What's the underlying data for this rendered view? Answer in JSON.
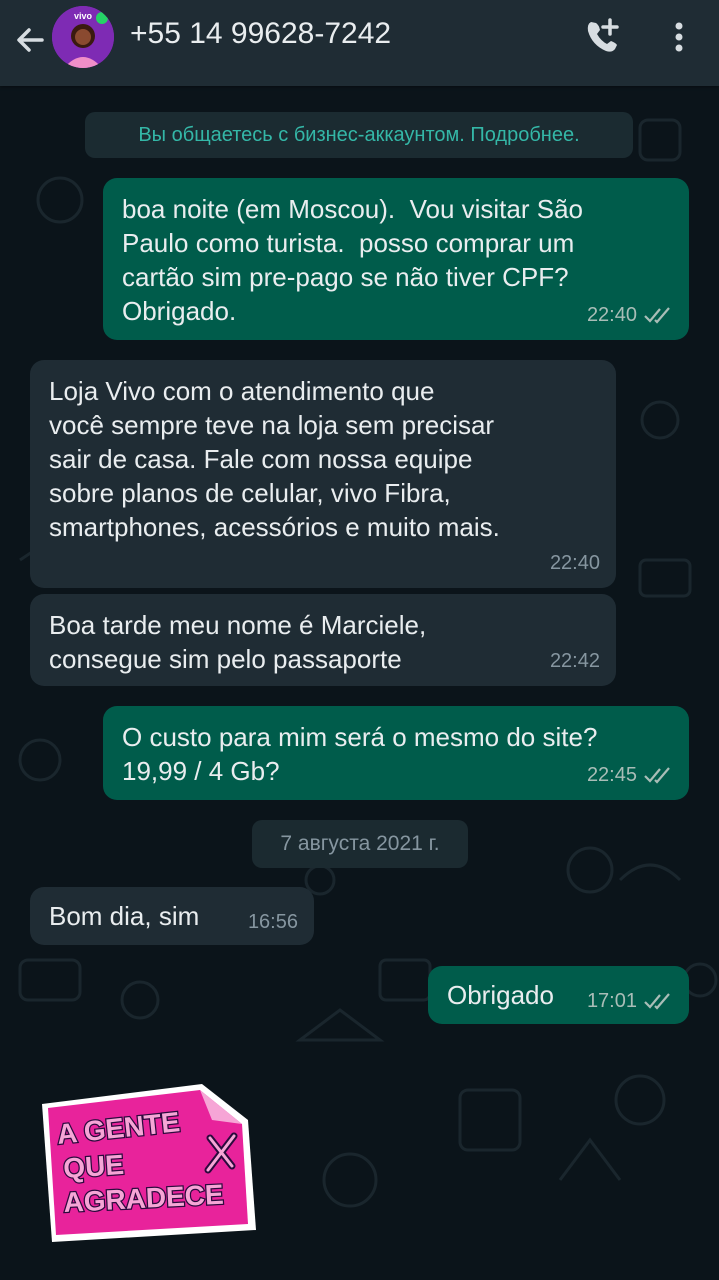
{
  "header": {
    "contact": "+55 14 99628-7242",
    "avatar_brand": "vivo",
    "icons": {
      "back": "arrow-left-icon",
      "call": "add-call-icon",
      "menu": "more-vert-icon"
    }
  },
  "system_notice": "Вы общаетесь с бизнес-аккаунтом. Подробнее.",
  "messages": [
    {
      "direction": "out",
      "text": "boa noite (em Moscou).  Vou visitar São\nPaulo como turista.  posso comprar um\ncartão sim pre-pago se não tiver CPF?\nObrigado.",
      "time": "22:40",
      "read": true
    },
    {
      "direction": "in",
      "text": "Loja Vivo com o atendimento que\nvocê sempre teve na loja sem precisar\nsair de casa. Fale com nossa equipe\nsobre planos de celular, vivo Fibra,\nsmartphones, acessórios e muito mais.",
      "time": "22:40"
    },
    {
      "direction": "in",
      "text": "Boa tarde meu nome é Marciele,\nconsegue sim pelo passaporte",
      "time": "22:42"
    },
    {
      "direction": "out",
      "text": "O custo para mim será o mesmo do site?\n19,99 / 4 Gb?",
      "time": "22:45",
      "read": true
    },
    {
      "direction": "in",
      "text": "Bom dia, sim",
      "time": "16:56"
    },
    {
      "direction": "out",
      "text": "Obrigado",
      "time": "17:01",
      "read": true
    }
  ],
  "date_divider": "7 августа 2021 г.",
  "sticker": {
    "lines": [
      "A GENTE",
      "QUE",
      "AGRADECE"
    ],
    "colors": {
      "bg": "#e8239b",
      "outline": "#2b0a3d",
      "fold": "#f6a5d6"
    }
  },
  "colors": {
    "background": "#0b141a",
    "header": "#1f2c34",
    "outgoing": "#005c4b",
    "incoming": "#1f2c34",
    "accent": "#34b7a7",
    "read_ticks": "#53bdeb"
  }
}
